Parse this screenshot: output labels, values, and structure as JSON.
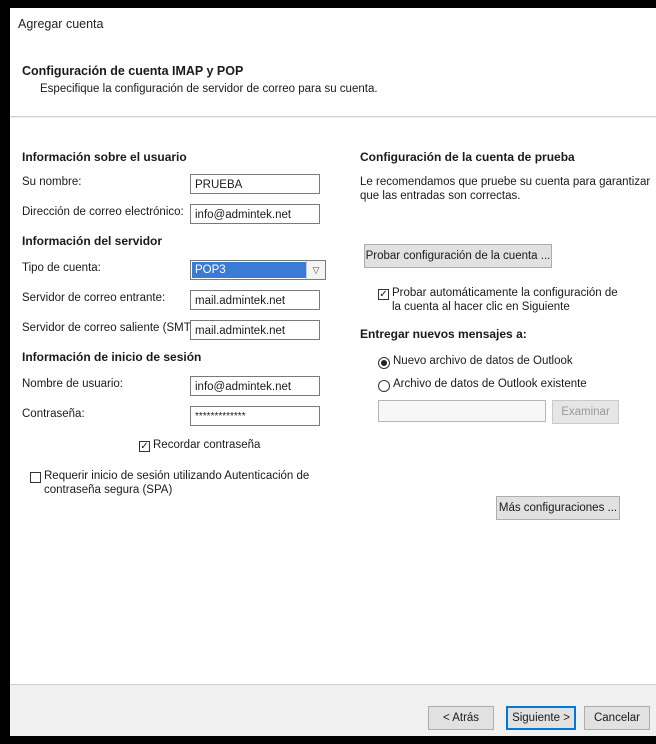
{
  "window": {
    "title": "Agregar cuenta"
  },
  "header": {
    "title": "Configuración de cuenta IMAP y POP",
    "subtitle": "Especifique la configuración de servidor de correo para su cuenta."
  },
  "user_info": {
    "heading": "Información sobre el usuario",
    "name_label": "Su nombre:",
    "name_value": "PRUEBA",
    "email_label": "Dirección de correo electrónico:",
    "email_value": "info@admintek.net"
  },
  "server_info": {
    "heading": "Información del servidor",
    "account_type_label": "Tipo de cuenta:",
    "account_type_value": "POP3",
    "incoming_label": "Servidor de correo entrante:",
    "incoming_value": "mail.admintek.net",
    "outgoing_label": "Servidor de correo saliente (SMTP):",
    "outgoing_value": "mail.admintek.net"
  },
  "login_info": {
    "heading": "Información de inicio de sesión",
    "username_label": "Nombre de usuario:",
    "username_value": "info@admintek.net",
    "password_label": "Contraseña:",
    "password_value": "*************",
    "remember_label": "Recordar contraseña",
    "remember_checked": true,
    "spa_label_line1": "Requerir inicio de sesión utilizando Autenticación de",
    "spa_label_line2": "contraseña segura (SPA)",
    "spa_checked": false
  },
  "test_settings": {
    "heading": "Configuración de la cuenta de prueba",
    "description_line1": "Le recomendamos que pruebe su cuenta para garantizar",
    "description_line2": "que las entradas son correctas.",
    "test_button": "Probar configuración de la cuenta ...",
    "auto_test_line1": "Probar automáticamente la configuración de",
    "auto_test_line2": "la cuenta al hacer clic en Siguiente",
    "auto_test_checked": true
  },
  "delivery": {
    "heading": "Entregar nuevos mensajes a:",
    "option_new": "Nuevo archivo de datos de Outlook",
    "option_existing": "Archivo de datos de Outlook existente",
    "selected": "new",
    "path_value": "",
    "browse_button": "Examinar"
  },
  "more_settings_button": "Más configuraciones ...",
  "footer": {
    "back_button": "< Atrás",
    "next_button": "Siguiente >",
    "cancel_button": "Cancelar"
  },
  "colors": {
    "selection": "#3a7bd5",
    "primary_border": "#0078d7"
  }
}
